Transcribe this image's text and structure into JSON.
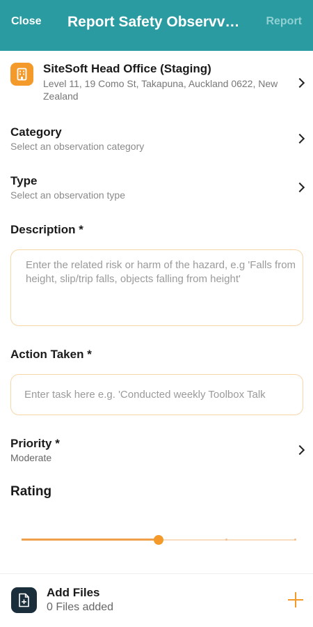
{
  "header": {
    "close_label": "Close",
    "title": "Report Safety Observv…",
    "report_label": "Report"
  },
  "site": {
    "icon": "building-icon",
    "name": "SiteSoft Head Office (Staging)",
    "address": "Level 11, 19 Como St, Takapuna, Auckland 0622, New Zealand"
  },
  "category": {
    "label": "Category",
    "placeholder": "Select an observation category"
  },
  "type": {
    "label": "Type",
    "placeholder": "Select an observation type"
  },
  "description": {
    "label": "Description *",
    "value": "",
    "placeholder": "Enter the related risk or harm of the hazard, e.g 'Falls from height, slip/trip falls, objects falling from height'"
  },
  "action_taken": {
    "label": "Action Taken *",
    "value": "",
    "placeholder": "Enter task here e.g. 'Conducted weekly Toolbox Talk"
  },
  "priority": {
    "label": "Priority *",
    "value": "Moderate"
  },
  "rating": {
    "label": "Rating",
    "value_fraction": 0.5,
    "steps": 4
  },
  "files": {
    "icon": "document-icon",
    "title": "Add Files",
    "count_text": "0 Files added",
    "add_icon": "plus-icon"
  },
  "colors": {
    "header": "#2a9ba0",
    "accent": "#f39a2b",
    "field_border": "#f7d6a8"
  }
}
